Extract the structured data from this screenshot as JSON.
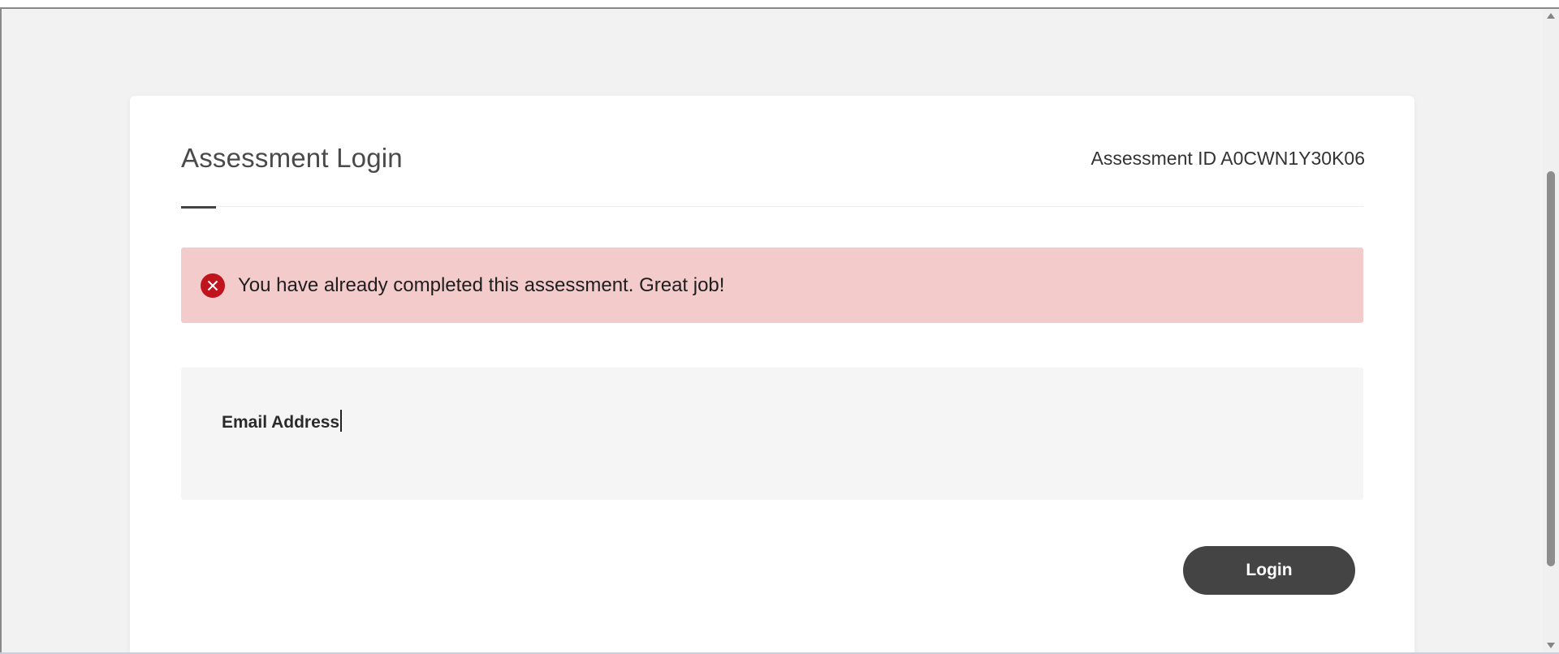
{
  "page": {
    "title": "Assessment Login",
    "assessment_id_text": "Assessment ID A0CWN1Y30K06"
  },
  "alert": {
    "message": "You have already completed this assessment. Great job!",
    "icon": "error-circle-x-icon",
    "color": "#c0141c",
    "background": "#f4cbcb"
  },
  "form": {
    "email_label": "Email Address",
    "email_value": "",
    "login_label": "Login"
  },
  "colors": {
    "page_background": "#f2f2f2",
    "button_background": "#444444",
    "panel_background": "#f5f5f5"
  }
}
